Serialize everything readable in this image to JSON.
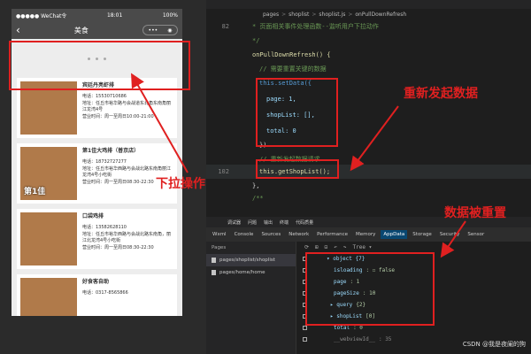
{
  "phone": {
    "status_carrier": "●●●●● WeChat令",
    "status_time": "18:01",
    "status_battery": "100%",
    "nav_back_glyph": "‹",
    "nav_title": "美食",
    "capsule_more_glyph": "•••",
    "capsule_close_glyph": "◉",
    "shops": [
      {
        "name": "宾廷丹亮虾排",
        "phone": "电话：15530710686",
        "address": "地址：任丘市裕华路与会战道东北角东南角丽江龙湾4号",
        "hours": "营业时间：周一至周日10:00-21:00",
        "thumb_text": ""
      },
      {
        "name": "第1佳大鸡排（普京店）",
        "phone": "电话：18732727277",
        "address": "地址：任丘市裕华西路与会战北路东南角丽江龙湾4号小吃街",
        "hours": "营业时间：周一至周日08:30-22:30",
        "thumb_text": "第1佳"
      },
      {
        "name": "口袋鸡排",
        "phone": "电话：13582628110",
        "address": "地址：任丘市裕华西路与会战北路东南角，丽江北龙湾4号小吃街",
        "hours": "营业时间：周一至周日08:30-22:30",
        "thumb_text": ""
      },
      {
        "name": "好食客自助",
        "phone": "电话：0317-8565866",
        "address": "",
        "hours": "",
        "thumb_text": ""
      }
    ]
  },
  "annotations": {
    "pull_label": "下拉操作",
    "refetch_label": "重新发起数据",
    "reset_label": "数据被重置"
  },
  "ide": {
    "breadcrumb": [
      "pages",
      "shoplist",
      "shoplist.js",
      "onPullDownRefresh"
    ],
    "breadcrumb_sep": ">",
    "lines": {
      "l1_num": "82",
      "l1_code": "* 页面相关事件处理函数--监听用户下拉动作",
      "l2_code": "*/",
      "l3_code": "onPullDownRefresh() {",
      "l4_code": "// 需要重置关键的数据",
      "l5_code": "this.setData({",
      "l6_code": "page: 1,",
      "l7_code": "shopList: [],",
      "l8_code": "total: 0",
      "l9_code": "})",
      "l10_code": "// 重新发起数据请求",
      "l11_num": "102",
      "l11_code": "this.getShopList();",
      "l12_code": "},",
      "l13_code": "/**"
    }
  },
  "devtools": {
    "top_tabs": [
      "调试器",
      "问题",
      "输出",
      "终端",
      "代码质量"
    ],
    "panel_tabs": [
      "Wxml",
      "Console",
      "Sources",
      "Network",
      "Performance",
      "Memory",
      "AppData",
      "Storage",
      "Security",
      "Sensor"
    ],
    "active_panel": "AppData",
    "pages_header": "Pages",
    "pages": [
      "pages/shoplist/shoplist",
      "pages/home/home"
    ],
    "toolbar_tree": "Tree ▾",
    "data_rows": [
      {
        "key": "▾ object {7}",
        "value": ""
      },
      {
        "key": "isloading",
        "value": ": ☐ false"
      },
      {
        "key": "page",
        "value": ": 1"
      },
      {
        "key": "pageSize",
        "value": ": 10"
      },
      {
        "key": "▸ query",
        "value": " {2}"
      },
      {
        "key": "▸ shopList",
        "value": " [0]"
      },
      {
        "key": "total",
        "value": ": 0"
      },
      {
        "key": "__webviewId__",
        "value": ": 35"
      }
    ]
  },
  "watermark": "CSDN @我是夜阑的狗",
  "colors": {
    "annotation_red": "#e02020",
    "appdata_tab_blue": "#094771"
  }
}
